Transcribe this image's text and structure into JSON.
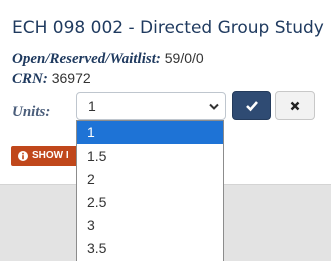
{
  "course": {
    "title": "ECH 098 002 - Directed Group Study",
    "seats_label": "Open/Reserved/Waitlist:",
    "seats_value": "59/0/0",
    "crn_label": "CRN:",
    "crn_value": "36972"
  },
  "units": {
    "label": "Units:",
    "selected": "1",
    "options": [
      "1",
      "1.5",
      "2",
      "2.5",
      "3",
      "3.5"
    ]
  },
  "buttons": {
    "confirm_icon": "check-icon",
    "cancel_icon": "close-icon",
    "show_info_label": "SHOW I",
    "show_info_icon": "info-circle-icon"
  },
  "colors": {
    "title": "#1f3a5f",
    "confirm_bg": "#2f4b73",
    "show_info_bg": "#c0471b",
    "dropdown_highlight": "#1e73d6"
  }
}
